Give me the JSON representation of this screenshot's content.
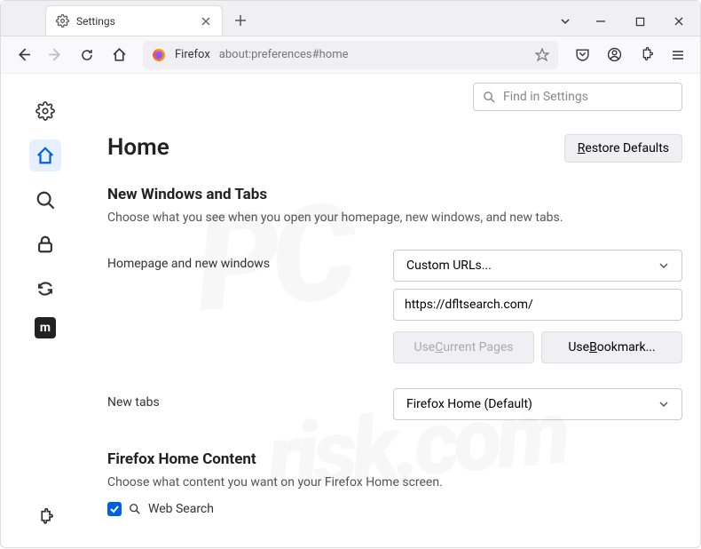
{
  "tab": {
    "title": "Settings"
  },
  "urlbar": {
    "identity": "Firefox",
    "url": "about:preferences#home"
  },
  "search": {
    "placeholder": "Find in Settings"
  },
  "page": {
    "title": "Home",
    "restore": "estore Defaults"
  },
  "sections": {
    "nwt": {
      "title": "New Windows and Tabs",
      "desc": "Choose what you see when you open your homepage, new windows, and new tabs."
    },
    "fhc": {
      "title": "Firefox Home Content",
      "desc": "Choose what content you want on your Firefox Home screen."
    }
  },
  "form": {
    "homepage_label": "Homepage and new windows",
    "homepage_select": "Custom URLs...",
    "homepage_url": "https://dfltsearch.com/",
    "use_current_prefix": "Use ",
    "use_current_u": "C",
    "use_current_suffix": "urrent Pages",
    "use_bookmark_prefix": "Use ",
    "use_bookmark_u": "B",
    "use_bookmark_suffix": "ookmark...",
    "newtabs_label": "New tabs",
    "newtabs_select": "Firefox Home (Default)"
  },
  "checkbox": {
    "web_search": "Web Search"
  }
}
